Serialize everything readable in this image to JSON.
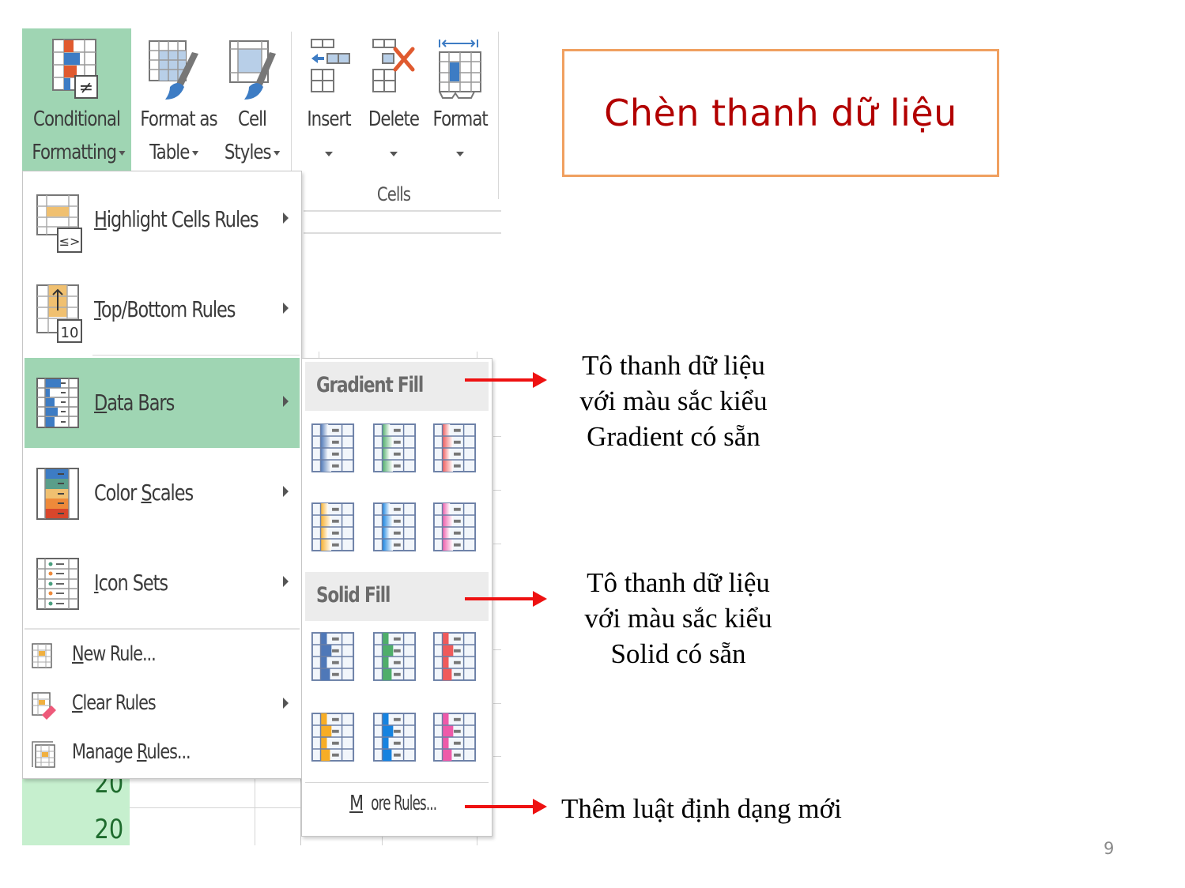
{
  "ribbon": {
    "buttons": [
      {
        "line1": "Conditional",
        "line2": "Formatting",
        "icon": "conditional-formatting-icon"
      },
      {
        "line1": "Format as",
        "line2": "Table",
        "icon": "format-as-table-icon"
      },
      {
        "line1": "Cell",
        "line2": "Styles",
        "icon": "cell-styles-icon"
      },
      {
        "line1": "Insert",
        "line2": "",
        "icon": "insert-cells-icon"
      },
      {
        "line1": "Delete",
        "line2": "",
        "icon": "delete-cells-icon"
      },
      {
        "line1": "Format",
        "line2": "",
        "icon": "format-cells-icon"
      }
    ],
    "group_label": "Cells"
  },
  "menu": {
    "items": [
      {
        "label_pre": "",
        "accel": "H",
        "label_post": "ighlight Cells Rules",
        "icon": "highlight-cells-icon",
        "submenu": true
      },
      {
        "label_pre": "",
        "accel": "T",
        "label_post": "op/Bottom Rules",
        "icon": "top-bottom-icon",
        "submenu": true
      },
      {
        "label_pre": "",
        "accel": "D",
        "label_post": "ata Bars",
        "icon": "data-bars-icon",
        "submenu": true,
        "active": true
      },
      {
        "label_pre": "Color ",
        "accel": "S",
        "label_post": "cales",
        "icon": "color-scales-icon",
        "submenu": true
      },
      {
        "label_pre": "",
        "accel": "I",
        "label_post": "con Sets",
        "icon": "icon-sets-icon",
        "submenu": true
      },
      {
        "label_pre": "",
        "accel": "N",
        "label_post": "ew Rule...",
        "icon": "new-rule-icon",
        "submenu": false
      },
      {
        "label_pre": "",
        "accel": "C",
        "label_post": "lear Rules",
        "icon": "clear-rules-icon",
        "submenu": true
      },
      {
        "label_pre": "Manage ",
        "accel": "R",
        "label_post": "ules...",
        "icon": "manage-rules-icon",
        "submenu": false
      }
    ]
  },
  "submenu": {
    "gradient_header": "Gradient Fill",
    "solid_header": "Solid Fill",
    "more_rules_accel": "M",
    "more_rules_rest": "ore Rules...",
    "colors": [
      {
        "name": "blue",
        "hex": "#4f78b8"
      },
      {
        "name": "green",
        "hex": "#4fae6a"
      },
      {
        "name": "red",
        "hex": "#f05a5a"
      },
      {
        "name": "orange",
        "hex": "#f7ad26"
      },
      {
        "name": "light-blue",
        "hex": "#1683e0"
      },
      {
        "name": "purple",
        "hex": "#ee5aa9"
      }
    ]
  },
  "sheet": {
    "values": [
      "20",
      "20"
    ],
    "fill_color": "#c6efce"
  },
  "callouts": {
    "title": "Chèn thanh dữ liệu",
    "gradient_note": [
      "Tô thanh dữ liệu",
      "với màu sắc kiểu",
      "Gradient có sẵn"
    ],
    "solid_note": [
      "Tô thanh dữ liệu",
      "với màu sắc kiểu",
      "Solid có sẵn"
    ],
    "more_rules_note": "Thêm luật định dạng mới"
  },
  "page_number": "9",
  "colors": {
    "selected_bg": "#9fd5b3",
    "title_text": "#b20000",
    "title_border": "#f0a060",
    "arrow": "#ee1111"
  }
}
